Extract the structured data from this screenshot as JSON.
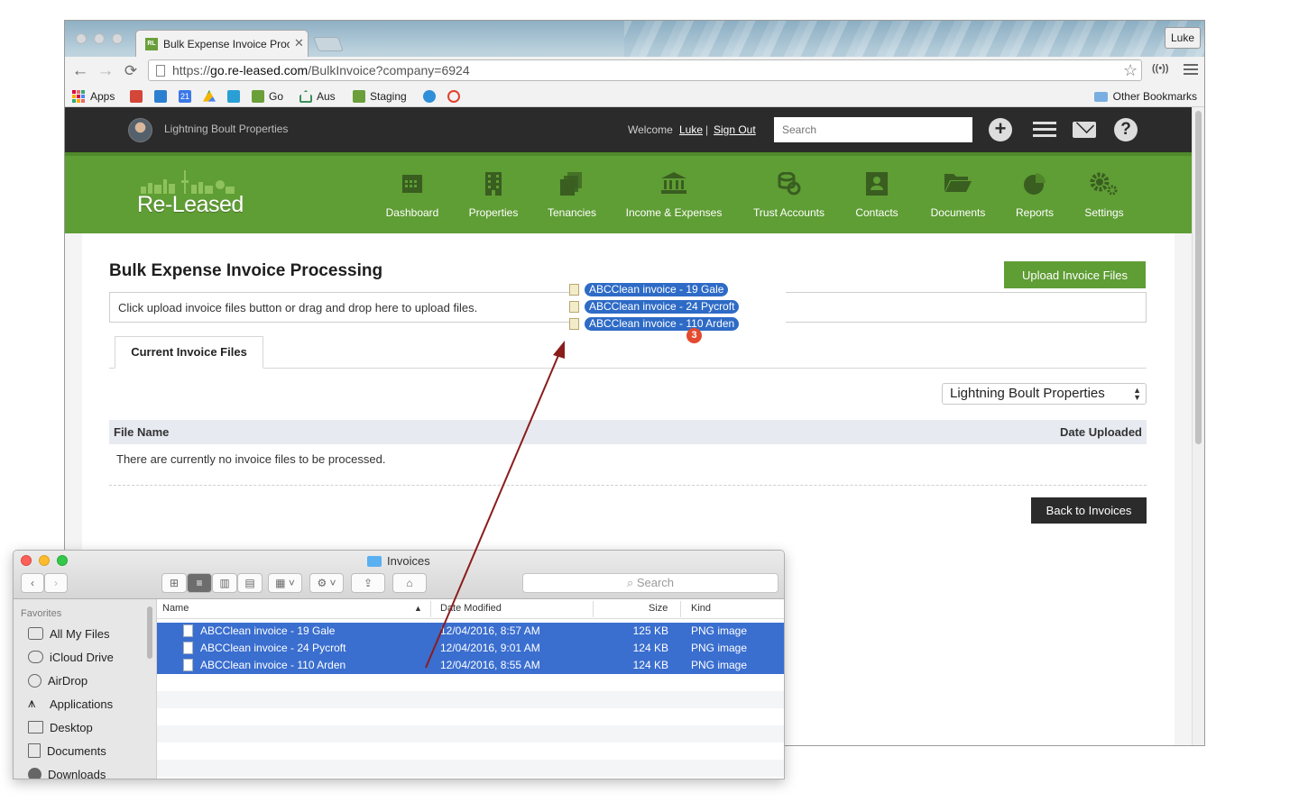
{
  "browser": {
    "tab_title": "Bulk Expense Invoice Proc",
    "tab_favicon": "RL",
    "profile": "Luke",
    "url_prefix": "https://",
    "url_domain": "go.re-leased.com",
    "url_path": "/BulkInvoice?company=6924",
    "bookmarks": [
      {
        "label": "Apps",
        "icon": "apps-icon"
      },
      {
        "label": "",
        "icon": "gmail-icon",
        "color": "#d44638"
      },
      {
        "label": "",
        "icon": "trello-icon",
        "color": "#2b7fd1"
      },
      {
        "label": "21",
        "icon": "calendar-icon",
        "color": "#3b78e7"
      },
      {
        "label": "",
        "icon": "drive-icon",
        "color": "#f2b400"
      },
      {
        "label": "",
        "icon": "c-icon",
        "color": "#2a9fd6"
      },
      {
        "label": "Go",
        "icon": "rl-icon",
        "color": "#6a9f3a"
      },
      {
        "label": "Aus",
        "icon": "home-icon",
        "color": "#3a8f5a"
      },
      {
        "label": "Staging",
        "icon": "rl-icon",
        "color": "#6a9f3a"
      },
      {
        "label": "",
        "icon": "cloud-icon",
        "color": "#2f8fd8"
      },
      {
        "label": "",
        "icon": "back-circle-icon",
        "color": "#e0412f"
      }
    ],
    "other_bookmarks": "Other Bookmarks"
  },
  "topbar": {
    "company": "Lightning Boult Properties",
    "welcome": "Welcome",
    "user": "Luke",
    "separator": "|",
    "sign_out": "Sign Out",
    "search_placeholder": "Search"
  },
  "nav": {
    "logo": "Re-Leased",
    "items": [
      {
        "label": "Dashboard",
        "icon": "calendar-icon"
      },
      {
        "label": "Properties",
        "icon": "building-icon"
      },
      {
        "label": "Tenancies",
        "icon": "stack-icon"
      },
      {
        "label": "Income & Expenses",
        "icon": "bank-icon"
      },
      {
        "label": "Trust Accounts",
        "icon": "coins-icon"
      },
      {
        "label": "Contacts",
        "icon": "contact-card-icon"
      },
      {
        "label": "Documents",
        "icon": "folder-open-icon"
      },
      {
        "label": "Reports",
        "icon": "pie-chart-icon"
      },
      {
        "label": "Settings",
        "icon": "gears-icon"
      }
    ]
  },
  "main": {
    "title": "Bulk Expense Invoice Processing",
    "upload_button": "Upload Invoice Files",
    "dropzone_text": "Click upload invoice files button or drag and drop here to upload files.",
    "tab": "Current Invoice Files",
    "company_select": "Lightning Boult Properties",
    "columns": {
      "file_name": "File Name",
      "date_uploaded": "Date Uploaded"
    },
    "empty_message": "There are currently no invoice files to be processed.",
    "back_button": "Back to Invoices"
  },
  "drag": {
    "items": [
      "ABCClean invoice - 19 Gale",
      "ABCClean invoice - 24 Pycroft",
      "ABCClean invoice - 110 Arden"
    ],
    "count": "3"
  },
  "finder": {
    "title": "Invoices",
    "search_placeholder": "Search",
    "favorites_header": "Favorites",
    "favorites": [
      {
        "label": "All My Files",
        "icon": "all-files-icon"
      },
      {
        "label": "iCloud Drive",
        "icon": "cloud-icon"
      },
      {
        "label": "AirDrop",
        "icon": "airdrop-icon"
      },
      {
        "label": "Applications",
        "icon": "applications-icon"
      },
      {
        "label": "Desktop",
        "icon": "desktop-icon"
      },
      {
        "label": "Documents",
        "icon": "documents-icon"
      },
      {
        "label": "Downloads",
        "icon": "downloads-icon"
      }
    ],
    "columns": {
      "name": "Name",
      "date_modified": "Date Modified",
      "size": "Size",
      "kind": "Kind"
    },
    "files": [
      {
        "name": "ABCClean invoice - 19 Gale",
        "date": "12/04/2016, 8:57 AM",
        "size": "125 KB",
        "kind": "PNG image"
      },
      {
        "name": "ABCClean invoice - 24 Pycroft",
        "date": "12/04/2016, 9:01 AM",
        "size": "124 KB",
        "kind": "PNG image"
      },
      {
        "name": "ABCClean invoice - 110 Arden",
        "date": "12/04/2016, 8:55 AM",
        "size": "124 KB",
        "kind": "PNG image"
      }
    ]
  },
  "colors": {
    "brand_green": "#5f9d35",
    "dark_bar": "#2b2b2b",
    "selection_blue": "#3a6ecf",
    "drag_arrow": "#8b1c1c"
  }
}
